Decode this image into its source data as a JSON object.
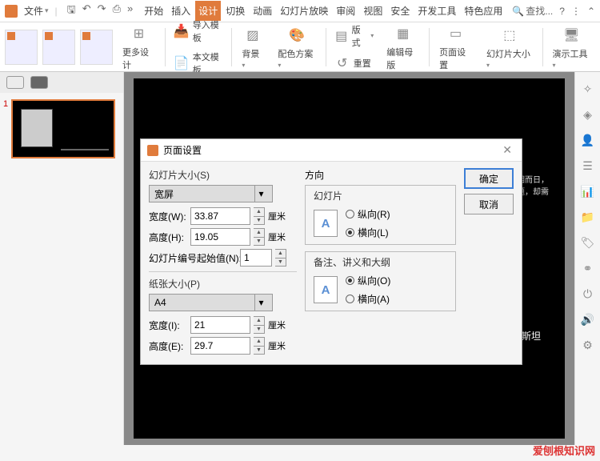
{
  "menubar": {
    "file": "文件",
    "tabs": [
      "开始",
      "插入",
      "设计",
      "切换",
      "动画",
      "幻灯片放映",
      "审阅",
      "视图",
      "安全",
      "开发工具",
      "特色应用"
    ],
    "active_tab": 2,
    "search": "查找...",
    "help": "?"
  },
  "ribbon": {
    "more_design": "更多设计",
    "import_tpl": "导入模板",
    "local_tpl": "本文模板",
    "background": "背景",
    "color_scheme": "配色方案",
    "layout": "版式",
    "reset": "重置",
    "edit_master": "编辑母版",
    "page_setup": "页面设置",
    "slide_size": "幻灯片大小",
    "present_tools": "演示工具"
  },
  "thumbnail": {
    "number": "1"
  },
  "slide": {
    "body_text": "重要，因为解决问相而日，而提出新看旧的问题，却需字的真正进步",
    "author": "—— 爱因斯坦"
  },
  "dialog": {
    "title": "页面设置",
    "slide_size_label": "幻灯片大小(S)",
    "slide_size_value": "宽屏",
    "width_label": "宽度(W):",
    "width_value": "33.87",
    "height_label": "高度(H):",
    "height_value": "19.05",
    "unit": "厘米",
    "start_num_label": "幻灯片编号起始值(N):",
    "start_num_value": "1",
    "paper_size_label": "纸张大小(P)",
    "paper_size_value": "A4",
    "paper_width_label": "宽度(I):",
    "paper_width_value": "21",
    "paper_height_label": "高度(E):",
    "paper_height_value": "29.7",
    "orientation_label": "方向",
    "slide_orient_label": "幻灯片",
    "portrait_r": "纵向(R)",
    "landscape_l": "横向(L)",
    "notes_label": "备注、讲义和大纲",
    "portrait_o": "纵向(O)",
    "landscape_a": "横向(A)",
    "ok": "确定",
    "cancel": "取消",
    "orient_glyph": "A"
  },
  "watermark": "爱刨根知识网"
}
